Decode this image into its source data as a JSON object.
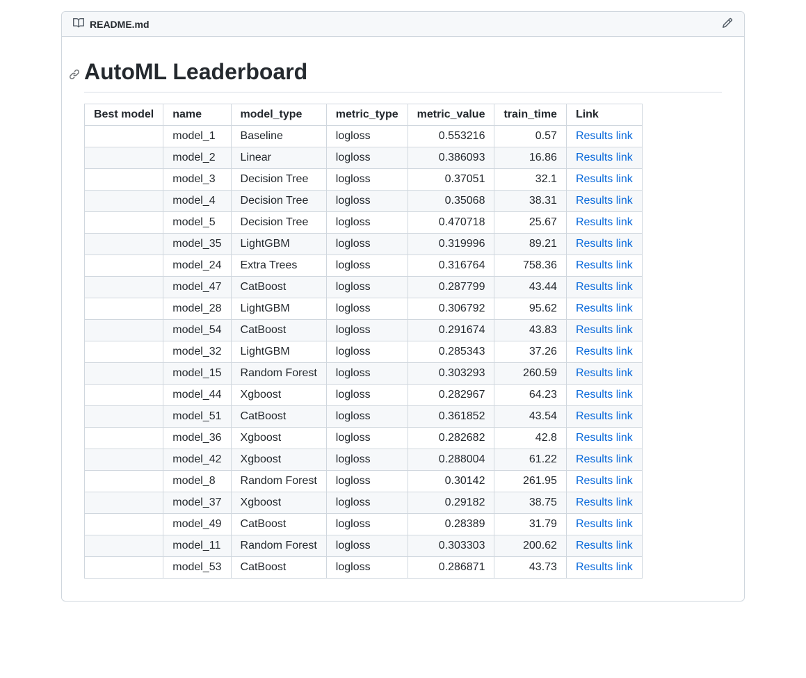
{
  "header": {
    "filename": "README.md"
  },
  "title": "AutoML Leaderboard",
  "columns": [
    "Best model",
    "name",
    "model_type",
    "metric_type",
    "metric_value",
    "train_time",
    "Link"
  ],
  "link_text": "Results link",
  "rows": [
    {
      "best": "",
      "name": "model_1",
      "model_type": "Baseline",
      "metric_type": "logloss",
      "metric_value": "0.553216",
      "train_time": "0.57"
    },
    {
      "best": "",
      "name": "model_2",
      "model_type": "Linear",
      "metric_type": "logloss",
      "metric_value": "0.386093",
      "train_time": "16.86"
    },
    {
      "best": "",
      "name": "model_3",
      "model_type": "Decision Tree",
      "metric_type": "logloss",
      "metric_value": "0.37051",
      "train_time": "32.1"
    },
    {
      "best": "",
      "name": "model_4",
      "model_type": "Decision Tree",
      "metric_type": "logloss",
      "metric_value": "0.35068",
      "train_time": "38.31"
    },
    {
      "best": "",
      "name": "model_5",
      "model_type": "Decision Tree",
      "metric_type": "logloss",
      "metric_value": "0.470718",
      "train_time": "25.67"
    },
    {
      "best": "",
      "name": "model_35",
      "model_type": "LightGBM",
      "metric_type": "logloss",
      "metric_value": "0.319996",
      "train_time": "89.21"
    },
    {
      "best": "",
      "name": "model_24",
      "model_type": "Extra Trees",
      "metric_type": "logloss",
      "metric_value": "0.316764",
      "train_time": "758.36"
    },
    {
      "best": "",
      "name": "model_47",
      "model_type": "CatBoost",
      "metric_type": "logloss",
      "metric_value": "0.287799",
      "train_time": "43.44"
    },
    {
      "best": "",
      "name": "model_28",
      "model_type": "LightGBM",
      "metric_type": "logloss",
      "metric_value": "0.306792",
      "train_time": "95.62"
    },
    {
      "best": "",
      "name": "model_54",
      "model_type": "CatBoost",
      "metric_type": "logloss",
      "metric_value": "0.291674",
      "train_time": "43.83"
    },
    {
      "best": "",
      "name": "model_32",
      "model_type": "LightGBM",
      "metric_type": "logloss",
      "metric_value": "0.285343",
      "train_time": "37.26"
    },
    {
      "best": "",
      "name": "model_15",
      "model_type": "Random Forest",
      "metric_type": "logloss",
      "metric_value": "0.303293",
      "train_time": "260.59"
    },
    {
      "best": "",
      "name": "model_44",
      "model_type": "Xgboost",
      "metric_type": "logloss",
      "metric_value": "0.282967",
      "train_time": "64.23"
    },
    {
      "best": "",
      "name": "model_51",
      "model_type": "CatBoost",
      "metric_type": "logloss",
      "metric_value": "0.361852",
      "train_time": "43.54"
    },
    {
      "best": "",
      "name": "model_36",
      "model_type": "Xgboost",
      "metric_type": "logloss",
      "metric_value": "0.282682",
      "train_time": "42.8"
    },
    {
      "best": "",
      "name": "model_42",
      "model_type": "Xgboost",
      "metric_type": "logloss",
      "metric_value": "0.288004",
      "train_time": "61.22"
    },
    {
      "best": "",
      "name": "model_8",
      "model_type": "Random Forest",
      "metric_type": "logloss",
      "metric_value": "0.30142",
      "train_time": "261.95"
    },
    {
      "best": "",
      "name": "model_37",
      "model_type": "Xgboost",
      "metric_type": "logloss",
      "metric_value": "0.29182",
      "train_time": "38.75"
    },
    {
      "best": "",
      "name": "model_49",
      "model_type": "CatBoost",
      "metric_type": "logloss",
      "metric_value": "0.28389",
      "train_time": "31.79"
    },
    {
      "best": "",
      "name": "model_11",
      "model_type": "Random Forest",
      "metric_type": "logloss",
      "metric_value": "0.303303",
      "train_time": "200.62"
    },
    {
      "best": "",
      "name": "model_53",
      "model_type": "CatBoost",
      "metric_type": "logloss",
      "metric_value": "0.286871",
      "train_time": "43.73"
    }
  ]
}
